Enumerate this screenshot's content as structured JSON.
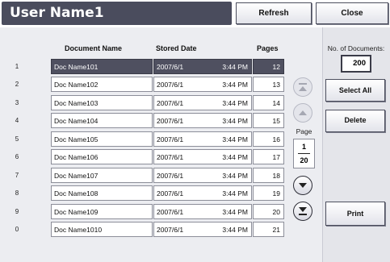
{
  "window": {
    "title": "User Name1",
    "refresh_label": "Refresh",
    "close_label": "Close"
  },
  "table": {
    "headers": [
      "Document Name",
      "Stored Date",
      "Pages"
    ],
    "rows": [
      {
        "index": "1",
        "name": "Doc Name101",
        "date": "2007/6/1",
        "time": "3:44 PM",
        "pages": "12"
      },
      {
        "index": "2",
        "name": "Doc Name102",
        "date": "2007/6/1",
        "time": "3:44 PM",
        "pages": "13"
      },
      {
        "index": "3",
        "name": "Doc Name103",
        "date": "2007/6/1",
        "time": "3:44 PM",
        "pages": "14"
      },
      {
        "index": "4",
        "name": "Doc Name104",
        "date": "2007/6/1",
        "time": "3:44 PM",
        "pages": "15"
      },
      {
        "index": "5",
        "name": "Doc Name105",
        "date": "2007/6/1",
        "time": "3:44 PM",
        "pages": "16"
      },
      {
        "index": "6",
        "name": "Doc Name106",
        "date": "2007/6/1",
        "time": "3:44 PM",
        "pages": "17"
      },
      {
        "index": "7",
        "name": "Doc Name107",
        "date": "2007/6/1",
        "time": "3:44 PM",
        "pages": "18"
      },
      {
        "index": "8",
        "name": "Doc Name108",
        "date": "2007/6/1",
        "time": "3:44 PM",
        "pages": "19"
      },
      {
        "index": "9",
        "name": "Doc Name109",
        "date": "2007/6/1",
        "time": "3:44 PM",
        "pages": "20"
      },
      {
        "index": "0",
        "name": "Doc Name1010",
        "date": "2007/6/1",
        "time": "3:44 PM",
        "pages": "21"
      }
    ],
    "selected_index": 0
  },
  "pager": {
    "label": "Page",
    "current": "1",
    "total": "20",
    "icons": [
      "scroll-first-icon",
      "scroll-up-icon",
      "scroll-down-icon",
      "scroll-last-icon"
    ]
  },
  "side": {
    "count_label": "No. of Documents:",
    "count_value": "200",
    "select_all_label": "Select All",
    "delete_label": "Delete",
    "print_label": "Print"
  },
  "colors": {
    "title_bar": "#4a4c5d",
    "selected_row": "#4f5060",
    "background": "#ecedf1"
  }
}
